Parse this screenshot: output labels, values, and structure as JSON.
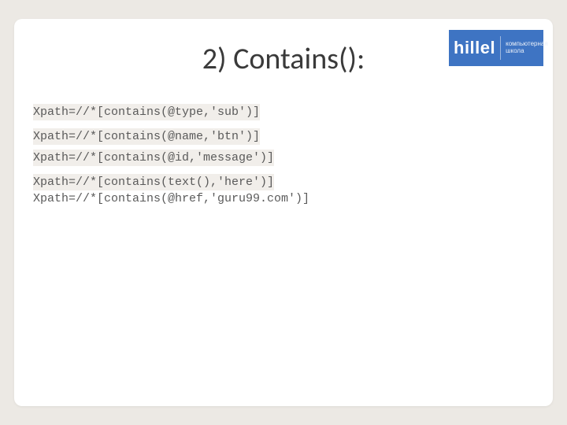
{
  "title": "2) Contains():",
  "logo": {
    "brand": "hillel",
    "sub1": "компьютерная",
    "sub2": "школа"
  },
  "code": {
    "l1": "Xpath=//*[contains(@type,'sub')]",
    "l2": "Xpath=//*[contains(@name,'btn')]",
    "l3": "Xpath=//*[contains(@id,'message')]",
    "l4": "Xpath=//*[contains(text(),'here')]",
    "l5": "Xpath=//*[contains(@href,'guru99.com')]"
  }
}
